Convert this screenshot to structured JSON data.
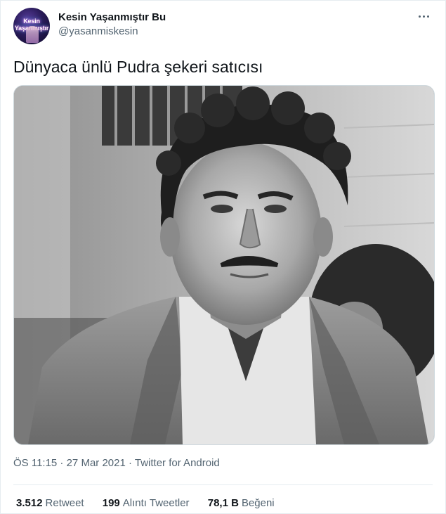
{
  "user": {
    "display_name": "Kesin Yaşanmıştır Bu",
    "handle": "@yasanmiskesin",
    "avatar_text": "Kesin Yaşanmıştır"
  },
  "tweet": {
    "text": "Dünyaca ünlü Pudra şekeri satıcısı",
    "meta": "ÖS 11:15 · 27 Mar 2021 · Twitter for Android"
  },
  "stats": [
    {
      "value": "3.512",
      "label": "Retweet"
    },
    {
      "value": "199",
      "label": "Alıntı Tweetler"
    },
    {
      "value": "78,1 B",
      "label": "Beğeni"
    }
  ],
  "icons": {
    "more": "more-options-icon"
  },
  "colors": {
    "text_primary": "#0f1419",
    "text_secondary": "#536471",
    "border": "#e6ecf0"
  }
}
